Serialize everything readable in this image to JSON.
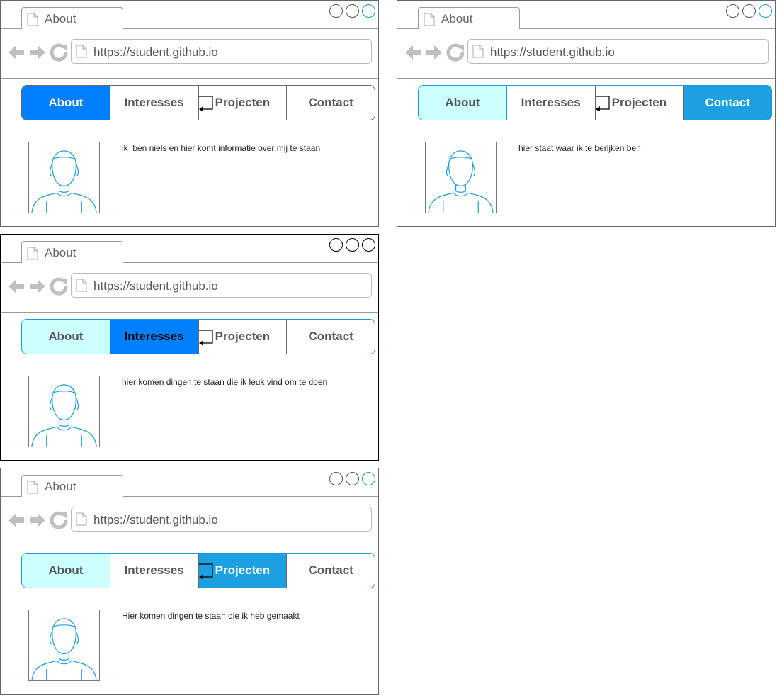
{
  "windows": [
    {
      "tab_title": "About",
      "url": "https://student.github.io",
      "nav": [
        "About",
        "Interesses",
        "Projecten",
        "Contact"
      ],
      "active": "About",
      "content": "ik  ben niels en hier komt informatie over mij te staan"
    },
    {
      "tab_title": "About",
      "url": "https://student.github.io",
      "nav": [
        "About",
        "Interesses",
        "Projecten",
        "Contact"
      ],
      "active": "Contact",
      "content": "hier staat waar ik te berijken ben"
    },
    {
      "tab_title": "About",
      "url": "https://student.github.io",
      "nav": [
        "About",
        "Interesses",
        "Projecten",
        "Contact"
      ],
      "active": "Interesses",
      "content": "hier komen dingen te staan die ik leuk vind om te doen"
    },
    {
      "tab_title": "About",
      "url": "https://student.github.io",
      "nav": [
        "About",
        "Interesses",
        "Projecten",
        "Contact"
      ],
      "active": "Projecten",
      "content": "Hier komen dingen te staan die ik heb gemaakt"
    }
  ],
  "colors": {
    "active_about": "#007fff",
    "active_contact": "#1ba1e2",
    "active_projecten": "#1ba1e2",
    "selected_about": "#ccffff",
    "window_control_accent": "#1a9be0"
  },
  "icons": [
    "document-icon",
    "back-arrow-icon",
    "forward-arrow-icon",
    "reload-icon",
    "user-avatar-icon",
    "link-arrow-icon"
  ]
}
